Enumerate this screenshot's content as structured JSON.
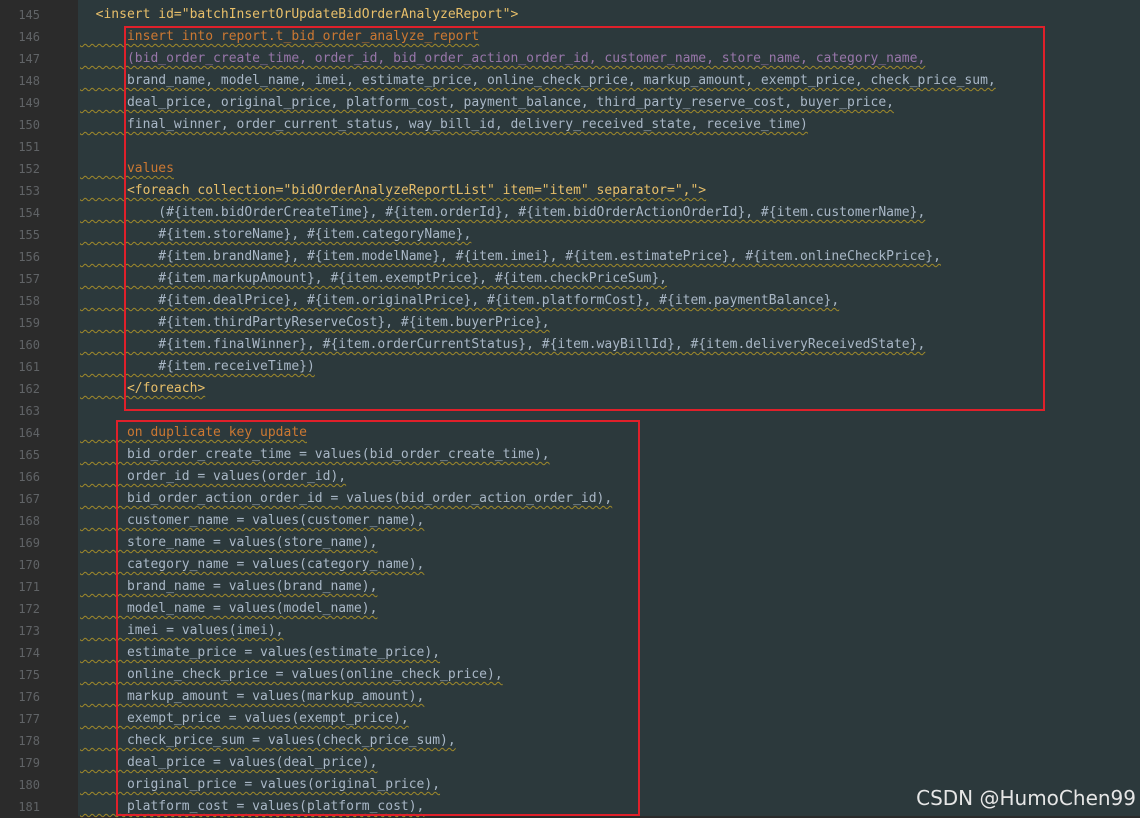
{
  "editor": {
    "lines": [
      {
        "n": "145",
        "text": "  <insert id=\"batchInsertOrUpdateBidOrderAnalyzeReport\">"
      },
      {
        "n": "146",
        "text": "      insert into report.t_bid_order_analyze_report"
      },
      {
        "n": "147",
        "text": "      (bid_order_create_time, order_id, bid_order_action_order_id, customer_name, store_name, category_name,"
      },
      {
        "n": "148",
        "text": "      brand_name, model_name, imei, estimate_price, online_check_price, markup_amount, exempt_price, check_price_sum,"
      },
      {
        "n": "149",
        "text": "      deal_price, original_price, platform_cost, payment_balance, third_party_reserve_cost, buyer_price,"
      },
      {
        "n": "150",
        "text": "      final_winner, order_current_status, way_bill_id, delivery_received_state, receive_time)"
      },
      {
        "n": "151",
        "text": ""
      },
      {
        "n": "152",
        "text": "      values"
      },
      {
        "n": "153",
        "text": "      <foreach collection=\"bidOrderAnalyzeReportList\" item=\"item\" separator=\",\">"
      },
      {
        "n": "154",
        "text": "          (#{item.bidOrderCreateTime}, #{item.orderId}, #{item.bidOrderActionOrderId}, #{item.customerName},"
      },
      {
        "n": "155",
        "text": "          #{item.storeName}, #{item.categoryName},"
      },
      {
        "n": "156",
        "text": "          #{item.brandName}, #{item.modelName}, #{item.imei}, #{item.estimatePrice}, #{item.onlineCheckPrice},"
      },
      {
        "n": "157",
        "text": "          #{item.markupAmount}, #{item.exemptPrice}, #{item.checkPriceSum},"
      },
      {
        "n": "158",
        "text": "          #{item.dealPrice}, #{item.originalPrice}, #{item.platformCost}, #{item.paymentBalance},"
      },
      {
        "n": "159",
        "text": "          #{item.thirdPartyReserveCost}, #{item.buyerPrice},"
      },
      {
        "n": "160",
        "text": "          #{item.finalWinner}, #{item.orderCurrentStatus}, #{item.wayBillId}, #{item.deliveryReceivedState},"
      },
      {
        "n": "161",
        "text": "          #{item.receiveTime})"
      },
      {
        "n": "162",
        "text": "      </foreach>"
      },
      {
        "n": "163",
        "text": ""
      },
      {
        "n": "164",
        "text": "      on duplicate key update"
      },
      {
        "n": "165",
        "text": "      bid_order_create_time = values(bid_order_create_time),"
      },
      {
        "n": "166",
        "text": "      order_id = values(order_id),"
      },
      {
        "n": "167",
        "text": "      bid_order_action_order_id = values(bid_order_action_order_id),"
      },
      {
        "n": "168",
        "text": "      customer_name = values(customer_name),"
      },
      {
        "n": "169",
        "text": "      store_name = values(store_name),"
      },
      {
        "n": "170",
        "text": "      category_name = values(category_name),"
      },
      {
        "n": "171",
        "text": "      brand_name = values(brand_name),"
      },
      {
        "n": "172",
        "text": "      model_name = values(model_name),"
      },
      {
        "n": "173",
        "text": "      imei = values(imei),"
      },
      {
        "n": "174",
        "text": "      estimate_price = values(estimate_price),"
      },
      {
        "n": "175",
        "text": "      online_check_price = values(online_check_price),"
      },
      {
        "n": "176",
        "text": "      markup_amount = values(markup_amount),"
      },
      {
        "n": "177",
        "text": "      exempt_price = values(exempt_price),"
      },
      {
        "n": "178",
        "text": "      check_price_sum = values(check_price_sum),"
      },
      {
        "n": "179",
        "text": "      deal_price = values(deal_price),"
      },
      {
        "n": "180",
        "text": "      original_price = values(original_price),"
      },
      {
        "n": "181",
        "text": "      platform_cost = values(platform_cost),"
      }
    ]
  },
  "watermark": "CSDN @HumoChen99",
  "colors": {
    "background": "#2c393c",
    "highlight_box": "#e0202a",
    "tag": "#e8bf6a",
    "keyword": "#cc7832",
    "column": "#9876aa",
    "string": "#6a8759"
  }
}
